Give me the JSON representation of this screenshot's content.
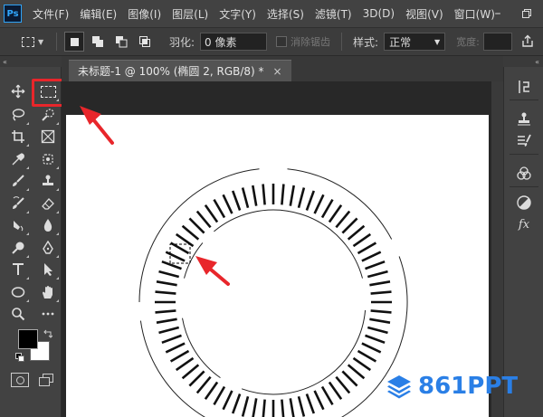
{
  "menubar": {
    "logo": "Ps",
    "items": [
      "文件(F)",
      "编辑(E)",
      "图像(I)",
      "图层(L)",
      "文字(Y)",
      "选择(S)",
      "滤镜(T)",
      "3D(D)",
      "视图(V)",
      "窗口(W)"
    ]
  },
  "options": {
    "feather_label": "羽化:",
    "feather_value": "0 像素",
    "antialias_label": "消除锯齿",
    "style_label": "样式:",
    "style_value": "正常",
    "width_label": "宽度:"
  },
  "document": {
    "tab_title": "未标题-1 @ 100% (椭圆 2, RGB/8) *",
    "close": "×"
  },
  "watermark": {
    "text": "861PPT"
  },
  "colors": {
    "highlight": "#e8262b",
    "watermark": "#2a7fe6"
  }
}
